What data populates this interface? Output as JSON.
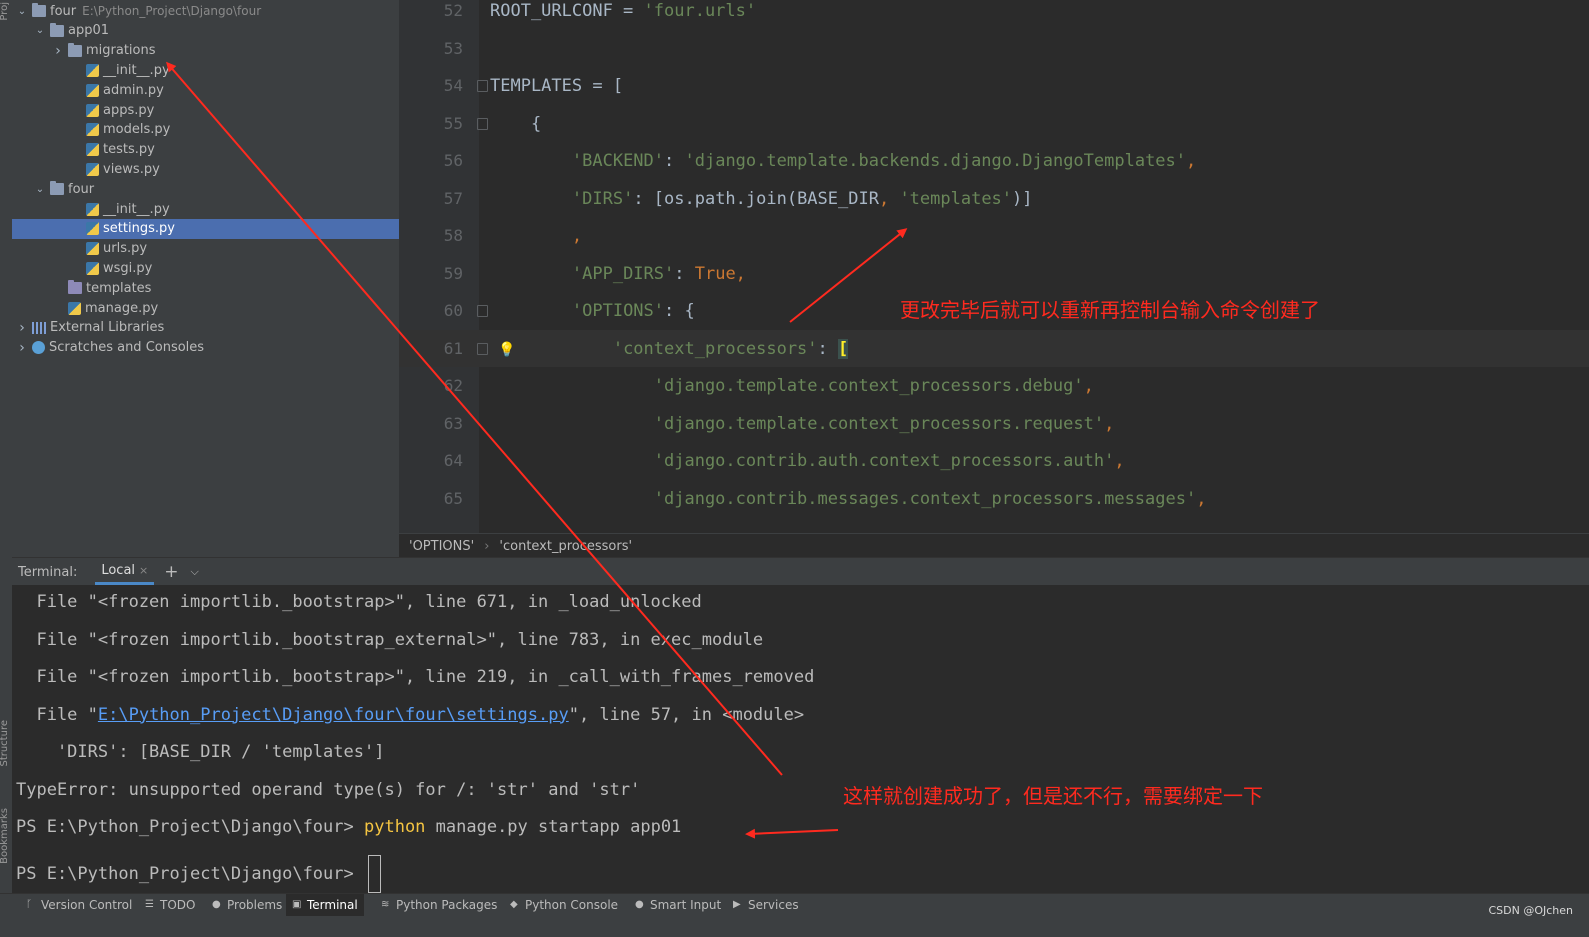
{
  "left_strip": {
    "project_label": "Proj",
    "structure_label": "Structure",
    "bookmarks_label": "Bookmarks"
  },
  "project_tree": [
    {
      "label": "four",
      "hint": "E:\\Python_Project\\Django\\four",
      "indent": 0,
      "expand": "open",
      "icon": "folder-icon"
    },
    {
      "label": "app01",
      "indent": 1,
      "expand": "open",
      "icon": "folder-icon"
    },
    {
      "label": "migrations",
      "indent": 2,
      "expand": "closed",
      "icon": "folder-icon"
    },
    {
      "label": "__init__.py",
      "indent": 3,
      "icon": "python-file-icon"
    },
    {
      "label": "admin.py",
      "indent": 3,
      "icon": "python-file-icon"
    },
    {
      "label": "apps.py",
      "indent": 3,
      "icon": "python-file-icon"
    },
    {
      "label": "models.py",
      "indent": 3,
      "icon": "python-file-icon"
    },
    {
      "label": "tests.py",
      "indent": 3,
      "icon": "python-file-icon"
    },
    {
      "label": "views.py",
      "indent": 3,
      "icon": "python-file-icon"
    },
    {
      "label": "four",
      "indent": 1,
      "expand": "open",
      "icon": "folder-icon"
    },
    {
      "label": "__init__.py",
      "indent": 3,
      "icon": "python-file-icon"
    },
    {
      "label": "settings.py",
      "indent": 3,
      "icon": "python-file-icon",
      "selected": true
    },
    {
      "label": "urls.py",
      "indent": 3,
      "icon": "python-file-icon"
    },
    {
      "label": "wsgi.py",
      "indent": 3,
      "icon": "python-file-icon"
    },
    {
      "label": "templates",
      "indent": 2,
      "icon": "folder-plain-icon"
    },
    {
      "label": "manage.py",
      "indent": 2,
      "icon": "python-file-icon"
    },
    {
      "label": "External Libraries",
      "indent": 0,
      "expand": "closed",
      "icon": "library-icon"
    },
    {
      "label": "Scratches and Consoles",
      "indent": 0,
      "expand": "closed",
      "icon": "scratch-icon"
    }
  ],
  "editor": {
    "lines": [
      {
        "n": "52",
        "tokens": [
          [
            "p",
            "ROOT_URLCONF = "
          ],
          [
            "s",
            "'four.urls'"
          ]
        ]
      },
      {
        "n": "53",
        "tokens": []
      },
      {
        "n": "54",
        "fold": true,
        "tokens": [
          [
            "p",
            "TEMPLATES = ["
          ]
        ]
      },
      {
        "n": "55",
        "fold": true,
        "tokens": [
          [
            "p",
            "    {"
          ]
        ]
      },
      {
        "n": "56",
        "tokens": [
          [
            "p",
            "        "
          ],
          [
            "s",
            "'BACKEND'"
          ],
          [
            "p",
            ": "
          ],
          [
            "s",
            "'django.template.backends.django.DjangoTemplates'"
          ],
          [
            "k",
            ","
          ]
        ]
      },
      {
        "n": "57",
        "tokens": [
          [
            "p",
            "        "
          ],
          [
            "s",
            "'DIRS'"
          ],
          [
            "p",
            ": [os.path.join(BASE_DIR"
          ],
          [
            "k",
            ", "
          ],
          [
            "s",
            "'templates'"
          ],
          [
            "p",
            ")]"
          ]
        ]
      },
      {
        "n": "58",
        "tokens": [
          [
            "p",
            "        "
          ],
          [
            "k",
            ","
          ]
        ]
      },
      {
        "n": "59",
        "tokens": [
          [
            "p",
            "        "
          ],
          [
            "s",
            "'APP_DIRS'"
          ],
          [
            "p",
            ": "
          ],
          [
            "k",
            "True,"
          ]
        ]
      },
      {
        "n": "60",
        "fold": true,
        "tokens": [
          [
            "p",
            "        "
          ],
          [
            "s",
            "'OPTIONS'"
          ],
          [
            "p",
            ": {"
          ]
        ]
      },
      {
        "n": "61",
        "fold": true,
        "caret": true,
        "bulb": true,
        "tokens": [
          [
            "p",
            "            "
          ],
          [
            "s",
            "'context_processors'"
          ],
          [
            "p",
            ": "
          ],
          [
            "h",
            "["
          ]
        ]
      },
      {
        "n": "62",
        "tokens": [
          [
            "p",
            "                "
          ],
          [
            "s",
            "'django.template.context_processors.debug'"
          ],
          [
            "k",
            ","
          ]
        ]
      },
      {
        "n": "63",
        "tokens": [
          [
            "p",
            "                "
          ],
          [
            "s",
            "'django.template.context_processors.request'"
          ],
          [
            "k",
            ","
          ]
        ]
      },
      {
        "n": "64",
        "tokens": [
          [
            "p",
            "                "
          ],
          [
            "s",
            "'django.contrib.auth.context_processors.auth'"
          ],
          [
            "k",
            ","
          ]
        ]
      },
      {
        "n": "65",
        "tokens": [
          [
            "p",
            "                "
          ],
          [
            "s",
            "'django.contrib.messages.context_processors.messages'"
          ],
          [
            "k",
            ","
          ]
        ]
      }
    ],
    "breadcrumb": [
      "'OPTIONS'",
      "'context_processors'"
    ]
  },
  "terminal": {
    "title": "Terminal:",
    "tab": "Local",
    "lines": [
      [
        [
          "p",
          "  File \"<frozen importlib._bootstrap>\", line 671, in _load_unlocked"
        ]
      ],
      [
        [
          "p",
          "  File \"<frozen importlib._bootstrap_external>\", line 783, in exec_module"
        ]
      ],
      [
        [
          "p",
          "  File \"<frozen importlib._bootstrap>\", line 219, in _call_with_frames_removed"
        ]
      ],
      [
        [
          "p",
          "  File \""
        ],
        [
          "link",
          "E:\\Python_Project\\Django\\four\\four\\settings.py"
        ],
        [
          "p",
          "\", line 57, in <module>"
        ]
      ],
      [
        [
          "p",
          "    'DIRS': [BASE_DIR / 'templates']"
        ]
      ],
      [
        [
          "p",
          "TypeError: unsupported operand type(s) for /: 'str' and 'str'"
        ]
      ],
      [
        [
          "p",
          "PS E:\\Python_Project\\Django\\four> "
        ],
        [
          "y",
          "python"
        ],
        [
          "p",
          " manage.py startapp app01"
        ]
      ],
      [
        [
          "p",
          "PS E:\\Python_Project\\Django\\four> "
        ],
        [
          "cursor",
          ""
        ]
      ]
    ]
  },
  "bottom_tabs": [
    {
      "label": "Version Control",
      "icon": "branch-icon",
      "glyph": "ᚴ"
    },
    {
      "label": "TODO",
      "icon": "list-icon",
      "glyph": "☰"
    },
    {
      "label": "Problems",
      "icon": "warning-icon",
      "glyph": "●"
    },
    {
      "label": "Terminal",
      "icon": "terminal-icon",
      "glyph": "▣",
      "active": true
    },
    {
      "label": "Python Packages",
      "icon": "layers-icon",
      "glyph": "≋"
    },
    {
      "label": "Python Console",
      "icon": "python-icon",
      "glyph": "◆"
    },
    {
      "label": "Smart Input",
      "icon": "smart-input-icon",
      "glyph": "●"
    },
    {
      "label": "Services",
      "icon": "services-icon",
      "glyph": "▶"
    }
  ],
  "watermark": "CSDN @OJchen",
  "annotations": {
    "top_note": "更改完毕后就可以重新再控制台输入命令创建了",
    "bottom_note": "这样就创建成功了，但是还不行，需要绑定一下"
  },
  "colors": {
    "annotation_red": "#ff2a1f",
    "selection": "#4b6eaf",
    "string_green": "#6a8759",
    "keyword_orange": "#cc7832"
  }
}
